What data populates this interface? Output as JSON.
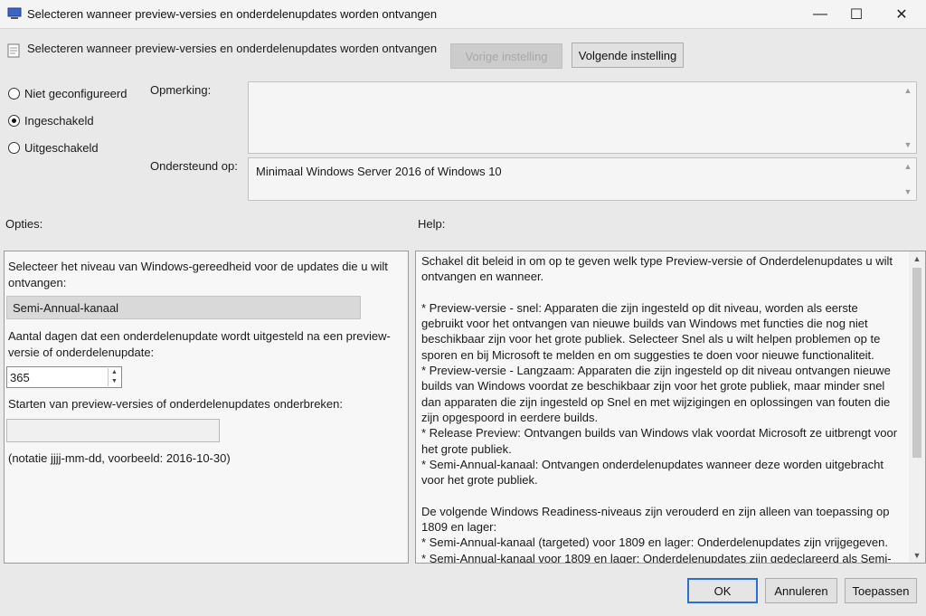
{
  "window": {
    "title": "Selecteren wanneer preview-versies en onderdelenupdates worden ontvangen",
    "icon": "policy-window-icon",
    "controls": {
      "minimize": "—",
      "maximize": "☐",
      "close": "✕"
    }
  },
  "header": {
    "policy_name": "Selecteren wanneer preview-versies en onderdelenupdates worden ontvangen",
    "prev_label": "Vorige instelling",
    "next_label": "Volgende instelling"
  },
  "state": {
    "options": [
      {
        "label": "Niet geconfigureerd",
        "checked": false
      },
      {
        "label": "Ingeschakeld",
        "checked": true
      },
      {
        "label": "Uitgeschakeld",
        "checked": false
      }
    ]
  },
  "comment": {
    "label": "Opmerking:",
    "value": ""
  },
  "supported": {
    "label": "Ondersteund op:",
    "value": "Minimaal Windows Server 2016 of Windows 10"
  },
  "options_label": "Opties:",
  "help_label": "Help:",
  "options": {
    "readiness_label": "Selecteer het niveau van Windows-gereedheid voor de updates die u wilt ontvangen:",
    "readiness_value": "Semi-Annual-kanaal",
    "defer_label": "Aantal dagen dat een onderdelenupdate wordt uitgesteld na een preview-versie of onderdelenupdate:",
    "defer_value": "365",
    "pause_label": "Starten van preview-versies of onderdelenupdates onderbreken:",
    "pause_value": "",
    "date_hint": "(notatie jjjj-mm-dd, voorbeeld: 2016-10-30)"
  },
  "help": {
    "paragraphs": [
      "Schakel dit beleid in om op te geven welk type Preview-versie of Onderdelenupdates u wilt ontvangen en wanneer.",
      "",
      "* Preview-versie - snel: Apparaten die zijn ingesteld op dit niveau, worden als eerste gebruikt voor het ontvangen van nieuwe builds van Windows met functies die nog niet beschikbaar zijn voor het grote publiek. Selecteer Snel als u wilt helpen problemen op te sporen en bij Microsoft te melden en om suggesties te doen voor nieuwe functionaliteit.",
      "* Preview-versie - Langzaam: Apparaten die zijn ingesteld op dit niveau ontvangen nieuwe builds van Windows voordat ze beschikbaar zijn voor het grote publiek, maar minder snel dan apparaten die zijn ingesteld op Snel en met wijzigingen en oplossingen van fouten die zijn opgespoord in eerdere builds.",
      "* Release Preview: Ontvangen builds van Windows vlak voordat Microsoft ze uitbrengt voor het grote publiek.",
      "* Semi-Annual-kanaal: Ontvangen onderdelenupdates wanneer deze worden uitgebracht voor het grote publiek.",
      "",
      "De volgende Windows Readiness-niveaus zijn verouderd en zijn alleen van toepassing op 1809 en lager:",
      "* Semi-Annual-kanaal (targeted) voor 1809 en lager: Onderdelenupdates zijn vrijgegeven.",
      "* Semi-Annual-kanaal voor 1809 en lager: Onderdelenupdates zijn gedeclareerd als Semi-"
    ]
  },
  "footer": {
    "ok": "OK",
    "cancel": "Annuleren",
    "apply": "Toepassen"
  }
}
